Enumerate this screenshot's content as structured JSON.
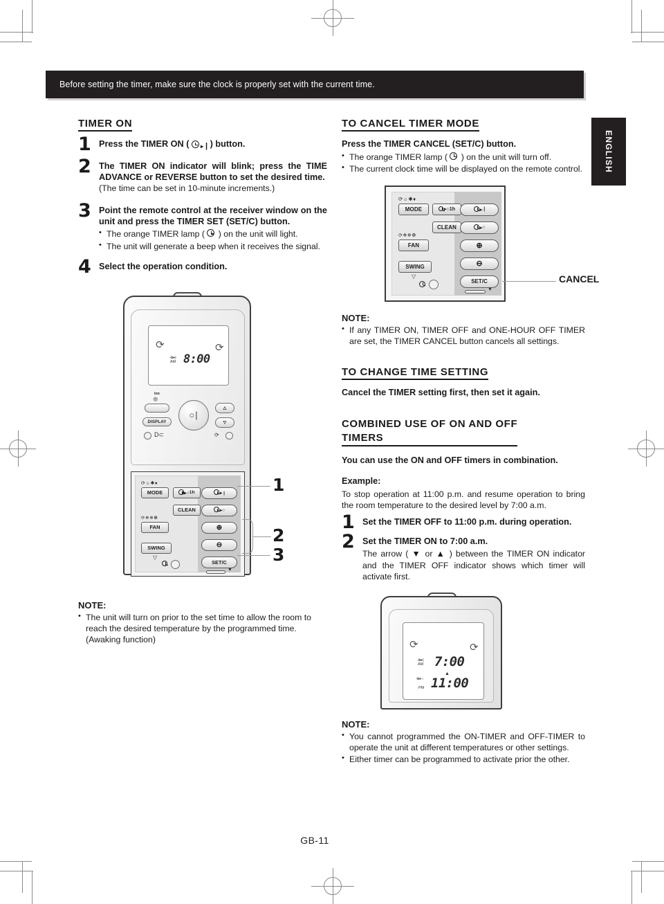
{
  "page": {
    "banner_text": "Before setting the timer, make sure the clock is properly set with the current time.",
    "side_tab": "ENGLISH",
    "footer": "GB-11"
  },
  "left_column": {
    "heading": "TIMER ON",
    "steps": [
      {
        "num": "1",
        "head_pre": "Press the TIMER ON (",
        "head_post": ") button.",
        "glyph": "timer-on-glyph"
      },
      {
        "num": "2",
        "head": "The TIMER ON indicator will blink; press the TIME ADVANCE or REVERSE button to set the desired time.",
        "sub": "(The time can be set in 10-minute increments.)"
      },
      {
        "num": "3",
        "head": "Point the remote control at the receiver window on the unit and press the TIMER SET (SET/C) button.",
        "bullets": [
          {
            "pre": "The orange TIMER lamp (",
            "post": ") on the unit will light.",
            "glyph": "clock-glyph"
          },
          {
            "pre": "The unit will generate a beep when it receives the signal.",
            "post": "",
            "glyph": ""
          }
        ]
      },
      {
        "num": "4",
        "head": "Select the operation condition."
      }
    ],
    "note": {
      "title": "NOTE:",
      "bullets": [
        "The unit will turn on prior to the set time to allow the room to reach the desired temperature by the programmed time. (Awaking function)"
      ]
    },
    "remote_callouts": [
      "1",
      "2",
      "3"
    ]
  },
  "remote_big": {
    "lcd": {
      "timer_on_label": "⊕▸|",
      "ampm": "AM",
      "time": "8:00"
    },
    "ion_label": "Ion",
    "buttons": {
      "display": "DISPLAY",
      "power": "○|",
      "mode": "MODE",
      "one_hour": "1h",
      "clean": "CLEAN",
      "fan": "FAN",
      "swing": "SWING",
      "plus": "⊕",
      "minus": "⊖",
      "set_c": "SET/C",
      "timer_on": "|",
      "timer_off": "○"
    }
  },
  "right_column": {
    "cancel_section": {
      "heading": "TO CANCEL TIMER MODE",
      "lead": "Press the TIMER CANCEL (SET/C) button.",
      "bullets": [
        {
          "pre": "The orange TIMER lamp (",
          "post": ") on the unit will turn off.",
          "glyph": "clock-glyph"
        },
        {
          "pre": "The current clock time will be displayed on the remote control.",
          "post": "",
          "glyph": ""
        }
      ],
      "callout_label": "CANCEL"
    },
    "note_1": {
      "title": "NOTE:",
      "bullets": [
        "If any TIMER ON, TIMER OFF and ONE-HOUR OFF TIMER are set, the TIMER CANCEL button cancels all settings."
      ]
    },
    "change_section": {
      "heading": "TO CHANGE TIME SETTING",
      "lead": "Cancel the TIMER setting first, then set it again."
    },
    "combined_section": {
      "heading_line1": "COMBINED USE OF ON AND OFF",
      "heading_line2": "TIMERS",
      "lead": "You can use the ON and OFF timers in combination.",
      "example_label": "Example:",
      "example_text": "To stop operation at 11:00 p.m. and resume operation to bring the room temperature to the desired level by 7:00 a.m.",
      "steps": [
        {
          "num": "1",
          "head": "Set the TIMER OFF to 11:00 p.m. during operation."
        },
        {
          "num": "2",
          "head": "Set the TIMER ON to 7:00 a.m.",
          "body_pre": "The arrow (",
          "body_mid": " or ",
          "body_post": ") between the TIMER ON indicator and the TIMER OFF indicator shows which timer will activate first.",
          "arrow_down": "▼",
          "arrow_up": "▲"
        }
      ]
    },
    "note_2": {
      "title": "NOTE:",
      "bullets": [
        "You cannot programmed the ON-TIMER and OFF-TIMER to operate the unit at different temperatures or other settings.",
        "Either timer can be programmed to activate prior the other."
      ]
    }
  },
  "remote_lcd": {
    "timer_on_label": "⊕▸|",
    "timer_on_ampm": "AM",
    "timer_on_time": "7:00",
    "arrow": "▲",
    "timer_off_label": "⊕▸○",
    "timer_off_ampm": "PM",
    "timer_off_time": "11:00"
  },
  "colors": {
    "ink": "#1a1a1a",
    "banner_bg": "#231f20",
    "banner_fg": "#ffffff",
    "crop_mark": "#8a8a8a",
    "remote_body": "#efefef",
    "remote_panel_dark": "#c8c8c8"
  }
}
